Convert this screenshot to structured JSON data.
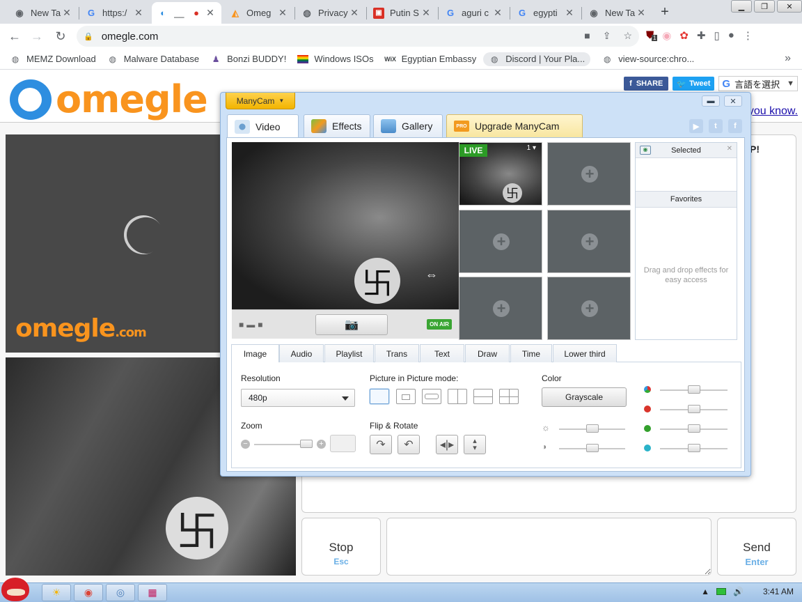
{
  "browser": {
    "tabs": [
      {
        "title": "New Ta",
        "icon": "chrome-icon"
      },
      {
        "title": "https:/",
        "icon": "google-icon"
      },
      {
        "title": "__",
        "icon": "omegle-icon",
        "active": true
      },
      {
        "title": "Omeg",
        "icon": "omegle-favicon"
      },
      {
        "title": "Privacy",
        "icon": "globe-icon"
      },
      {
        "title": "Putin S",
        "icon": "red-square-icon"
      },
      {
        "title": "aguri c",
        "icon": "google-icon"
      },
      {
        "title": "egypti",
        "icon": "google-icon"
      },
      {
        "title": "New Ta",
        "icon": "chrome-icon"
      }
    ],
    "new_tab_label": "+",
    "url": "omegle.com",
    "bookmarks": [
      {
        "label": "MEMZ Download",
        "icon": "globe-icon"
      },
      {
        "label": "Malware Database",
        "icon": "globe-icon"
      },
      {
        "label": "Bonzi BUDDY!",
        "icon": "bonzi-icon"
      },
      {
        "label": "Windows ISOs",
        "icon": "rainbow-flag-icon"
      },
      {
        "label": "Egyptian Embassy",
        "icon": "wix-icon"
      },
      {
        "label": "Discord | Your Pla...",
        "icon": "globe-icon"
      },
      {
        "label": "view-source:chro...",
        "icon": "globe-icon"
      }
    ],
    "ext_badge": "1"
  },
  "omegle": {
    "logo": "omegle",
    "share_label": "SHARE",
    "tweet_label": "Tweet",
    "translate_label": "言語を選択",
    "you_know": "you know.",
    "video_logo": "omegle",
    "video_logo_suffix": ".com",
    "chat_p": "P!",
    "stop_label": "Stop",
    "stop_key": "Esc",
    "send_label": "Send",
    "send_key": "Enter"
  },
  "manycam": {
    "menu_label": "ManyCam",
    "tabs": [
      "Video",
      "Effects",
      "Gallery",
      "Upgrade ManyCam"
    ],
    "pro_badge": "PRO",
    "social": [
      "▶",
      "t",
      "f"
    ],
    "live_badge": "LIVE",
    "live_number": "1",
    "on_air": "ON AIR",
    "selected_label": "Selected",
    "favorites_label": "Favorites",
    "hint": "Drag and drop effects for easy access",
    "control_tabs": [
      "Image",
      "Audio",
      "Playlist",
      "Trans",
      "Text",
      "Draw",
      "Time",
      "Lower third"
    ],
    "resolution_label": "Resolution",
    "resolution_value": "480p",
    "zoom_label": "Zoom",
    "pip_label": "Picture in Picture mode:",
    "flip_label": "Flip & Rotate",
    "color_label": "Color",
    "grayscale_label": "Grayscale",
    "levels": {
      "zoom": 0.92,
      "brightness": 0.5,
      "contrast": 0.5,
      "red": 0.5,
      "green": 0.5,
      "blue": 0.5,
      "rgb": 0.5
    }
  },
  "taskbar": {
    "clock": "3:41 AM"
  },
  "colors": {
    "omegle_orange": "#f9941e",
    "omegle_blue": "#2e8ee0",
    "live_green": "#2c9b26",
    "manycam_yellow": "#f2b400"
  }
}
